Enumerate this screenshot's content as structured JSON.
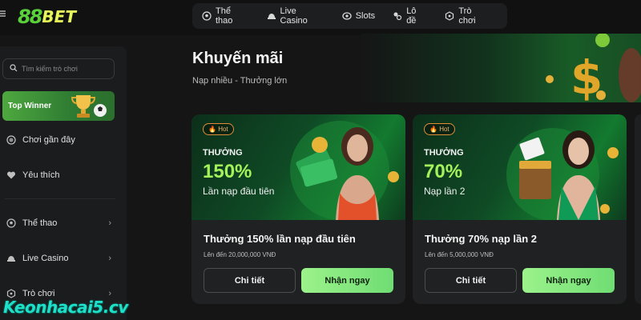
{
  "brand": {
    "logo_num": "88",
    "logo_text": "BET"
  },
  "topnav": [
    {
      "label": "Thể thao",
      "icon": "soccer-ball-icon"
    },
    {
      "label": "Live Casino",
      "icon": "casino-table-icon"
    },
    {
      "label": "Slots",
      "icon": "slot-icon"
    },
    {
      "label": "Lô đề",
      "icon": "lottery-icon"
    },
    {
      "label": "Trò chơi",
      "icon": "game-icon"
    }
  ],
  "sidebar": {
    "search_placeholder": "Tìm kiếm trò chơi",
    "top_winner": "Top Winner",
    "items": [
      {
        "label": "Chơi gần đây",
        "icon": "history-icon"
      },
      {
        "label": "Yêu thích",
        "icon": "heart-icon"
      },
      {
        "label": "Thể thao",
        "icon": "soccer-ball-icon"
      },
      {
        "label": "Live Casino",
        "icon": "casino-table-icon"
      },
      {
        "label": "Trò chơi",
        "icon": "game-icon"
      }
    ]
  },
  "main": {
    "title": "Khuyến mãi",
    "subtitle": "Nạp nhiều - Thưởng lớn"
  },
  "promotions": [
    {
      "badge": "Hot",
      "heading": "THƯỞNG",
      "percent": "150%",
      "sub": "Lần nạp đầu tiên",
      "title": "Thưởng 150% lần nạp đầu tiên",
      "limit": "Lên đến 20,000,000 VNĐ",
      "detail_label": "Chi tiết",
      "claim_label": "Nhận ngay"
    },
    {
      "badge": "Hot",
      "heading": "THƯỞNG",
      "percent": "70%",
      "sub": "Nạp lần 2",
      "title": "Thưởng 70% nạp lần 2",
      "limit": "Lên đến 5,000,000 VNĐ",
      "detail_label": "Chi tiết",
      "claim_label": "Nhận ngay"
    }
  ],
  "watermark": "Keonhacai5.cv",
  "colors": {
    "accent_green": "#a4f25b",
    "claim_button": "#86e880",
    "hot_badge": "#e28c37",
    "background": "#151516"
  }
}
